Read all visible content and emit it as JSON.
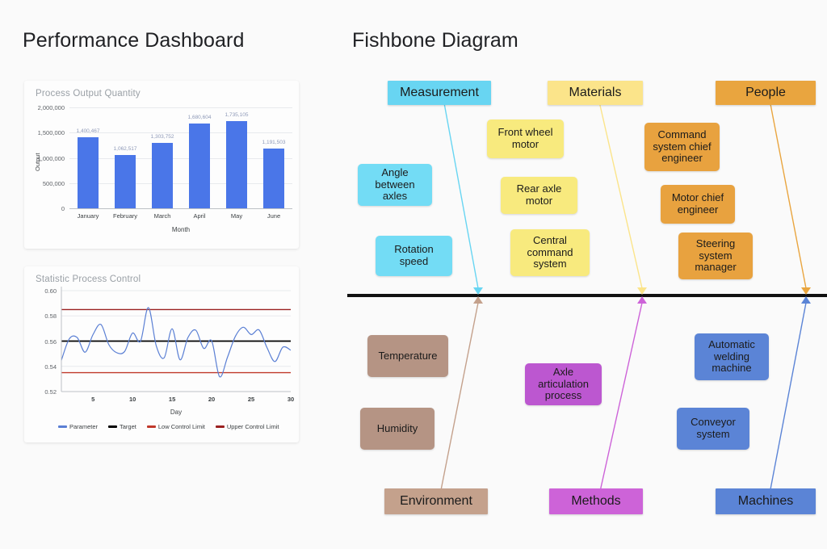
{
  "dashboard": {
    "title": "Performance Dashboard"
  },
  "fishbone": {
    "title": "Fishbone Diagram",
    "spine_color": "#111111",
    "categories": [
      {
        "id": "measurement",
        "label": "Measurement",
        "color": "#68d5f2",
        "position": "top"
      },
      {
        "id": "materials",
        "label": "Materials",
        "color": "#fbe48a",
        "position": "top"
      },
      {
        "id": "people",
        "label": "People",
        "color": "#e9a53f",
        "position": "top"
      },
      {
        "id": "environment",
        "label": "Environment",
        "color": "#c4a18c",
        "position": "bottom"
      },
      {
        "id": "methods",
        "label": "Methods",
        "color": "#cd63d8",
        "position": "bottom"
      },
      {
        "id": "machines",
        "label": "Machines",
        "color": "#5b84d6",
        "position": "bottom"
      }
    ],
    "causes": {
      "measurement": [
        {
          "label": "Angle\nbetween\naxles",
          "color": "#73dcf5"
        },
        {
          "label": "Rotation\nspeed",
          "color": "#73dcf5"
        }
      ],
      "materials": [
        {
          "label": "Front wheel\nmotor",
          "color": "#f8ea7e"
        },
        {
          "label": "Rear axle\nmotor",
          "color": "#f8ea7e"
        },
        {
          "label": "Central\ncommand\nsystem",
          "color": "#f8ea7e"
        }
      ],
      "people": [
        {
          "label": "Command\nsystem chief\nengineer",
          "color": "#e8a23f"
        },
        {
          "label": "Motor chief\nengineer",
          "color": "#e8a23f"
        },
        {
          "label": "Steering\nsystem\nmanager",
          "color": "#e8a23f"
        }
      ],
      "environment": [
        {
          "label": "Temperature",
          "color": "#b59484"
        },
        {
          "label": "Humidity",
          "color": "#b59484"
        }
      ],
      "methods": [
        {
          "label": "Axle\narticulation\nprocess",
          "color": "#bc57d0"
        }
      ],
      "machines": [
        {
          "label": "Automatic\nwelding\nmachine",
          "color": "#5b84d6"
        },
        {
          "label": "Conveyor\nsystem",
          "color": "#5b84d6"
        }
      ]
    }
  },
  "chart_data": [
    {
      "type": "bar",
      "title": "Process Output Quantity",
      "xlabel": "Month",
      "ylabel": "Output",
      "categories": [
        "January",
        "February",
        "March",
        "April",
        "May",
        "June"
      ],
      "values": [
        1400467,
        1062517,
        1303752,
        1680604,
        1735105,
        1191503
      ],
      "value_labels": [
        "1,400,467",
        "1,062,517",
        "1,303,752",
        "1,680,604",
        "1,735,105",
        "1,191,503"
      ],
      "ylim": [
        0,
        2000000
      ],
      "yticks": [
        0,
        500000,
        1000000,
        1500000,
        2000000
      ],
      "ytick_labels": [
        "0",
        "500,000",
        "1,000,000",
        "1,500,000",
        "2,000,000"
      ],
      "bar_color": "#4a76e8",
      "grid": true,
      "legend": "none"
    },
    {
      "type": "line",
      "title": "Statistic Process Control",
      "xlabel": "Day",
      "ylabel": "",
      "ylim": [
        0.52,
        0.6
      ],
      "yticks": [
        0.52,
        0.54,
        0.56,
        0.58,
        0.6
      ],
      "ytick_labels": [
        "0.52",
        "0.54",
        "0.56",
        "0.58",
        "0.60"
      ],
      "xlim": [
        1,
        30
      ],
      "xticks": [
        5,
        10,
        15,
        20,
        25,
        30
      ],
      "xtick_labels": [
        "5",
        "10",
        "15",
        "20",
        "25",
        "30"
      ],
      "grid": true,
      "legend_position": "bottom",
      "series": [
        {
          "name": "Parameter",
          "color": "#5a7fd4",
          "x": [
            1,
            2,
            3,
            4,
            5,
            6,
            7,
            8,
            9,
            10,
            11,
            12,
            13,
            14,
            15,
            16,
            17,
            18,
            19,
            20,
            21,
            22,
            23,
            24,
            25,
            26,
            27,
            28,
            29,
            30
          ],
          "values": [
            0.5448,
            0.5618,
            0.5628,
            0.5512,
            0.5652,
            0.5732,
            0.5572,
            0.5508,
            0.5518,
            0.5664,
            0.5598,
            0.5866,
            0.5562,
            0.5468,
            0.5698,
            0.5452,
            0.5628,
            0.5686,
            0.5542,
            0.5602,
            0.5318,
            0.5472,
            0.5638,
            0.571,
            0.5652,
            0.5688,
            0.5548,
            0.5438,
            0.5552,
            0.5528
          ]
        },
        {
          "name": "Target",
          "color": "#000000",
          "constant": 0.56
        },
        {
          "name": "Low Control Limit",
          "color": "#c0392b",
          "constant": 0.535
        },
        {
          "name": "Upper Control Limit",
          "color": "#9b2020",
          "constant": 0.585
        }
      ],
      "legend_entries": [
        {
          "label": "Parameter",
          "color": "#5a7fd4"
        },
        {
          "label": "Target",
          "color": "#000000"
        },
        {
          "label": "Low Control Limit",
          "color": "#c0392b"
        },
        {
          "label": "Upper Control Limit",
          "color": "#9b2020"
        }
      ]
    }
  ]
}
